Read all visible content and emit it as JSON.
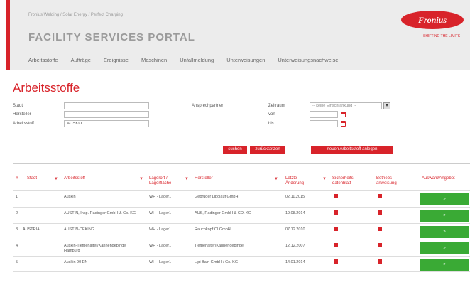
{
  "header": {
    "breadcrumb": "Fronius Welding / Solar Energy / Perfect Charging",
    "portal_title": "FACILITY SERVICES PORTAL",
    "logo_text": "Fronius",
    "logo_tagline": "SHIFTING THE LIMITS",
    "brand_color": "#d8232a"
  },
  "nav": {
    "items": [
      {
        "label": "Arbeitsstoffe"
      },
      {
        "label": "Aufträge"
      },
      {
        "label": "Ereignisse"
      },
      {
        "label": "Maschinen"
      },
      {
        "label": "Unfallmeldung"
      },
      {
        "label": "Unterweisungen"
      },
      {
        "label": "Unterweisungsnachweise"
      }
    ]
  },
  "page": {
    "title": "Arbeitsstoffe"
  },
  "filters": {
    "stadt_label": "Stadt",
    "stadt_value": "",
    "hersteller_label": "Hersteller",
    "hersteller_value": "",
    "arbeitsstoff_label": "Arbeitsstoff",
    "arbeitsstoff_value": "AUSKO",
    "ansprechpartner_label": "Ansprechpartner",
    "zeitraum_label": "Zeitraum",
    "zeitraum_value": "-- keine Einschränkung --",
    "von_label": "von",
    "von_value": "",
    "bis_label": "bis",
    "bis_value": "",
    "search_button": "suchen",
    "reset_button": "zurücksetzen",
    "new_button": "neuen Arbeitsstoff anlegen"
  },
  "table": {
    "headers": {
      "nr": "#",
      "stadt": "Stadt",
      "arbeitsstoff": "Arbeitsstoff",
      "lagerort": "Lagerort / Lagerfläche",
      "hersteller": "Hersteller",
      "letzte_aenderung": "Letzte Änderung",
      "sicherheitsdatenblatt": "Sicherheits-datenblatt",
      "betriebsanweisung": "Betriebs-anweisung",
      "auswahl": "Auswahl/Angebot"
    },
    "rows": [
      {
        "nr": "1",
        "stadt": "",
        "arbeitsstoff": "Auskin",
        "lagerort": "WH - Lager1",
        "hersteller": "Gebrüder Lipolauf GmbH",
        "datum": "02.11.2015",
        "action": "»"
      },
      {
        "nr": "2",
        "stadt": "",
        "arbeitsstoff": "AUSTIN, Insp. Radinger GmbH & Co. KG",
        "lagerort": "WH - Lager1",
        "hersteller": "AUS, Radinger GmbH & CO. KG",
        "datum": "19.08.2014",
        "action": "»"
      },
      {
        "nr": "3",
        "stadt": "AUSTRIA",
        "arbeitsstoff": "AUSTIN-DEKING",
        "lagerort": "WH - Lager1",
        "hersteller": "Rauchkopf Öl GmbH",
        "datum": "07.12.2010",
        "action": "»"
      },
      {
        "nr": "4",
        "stadt": "",
        "arbeitsstoff": "Auskin-Tiefbehälter/Kannengebinde Hamburg",
        "lagerort": "WH - Lager1",
        "hersteller": "Tiefbehälter/Kannengebinde",
        "datum": "12.12.2007",
        "action": "»"
      },
      {
        "nr": "5",
        "stadt": "",
        "arbeitsstoff": "Auskin 90 EN",
        "lagerort": "WH - Lager1",
        "hersteller": "Lipi Bain GmbH / Co. KG",
        "datum": "14.01.2014",
        "action": "»"
      }
    ]
  }
}
